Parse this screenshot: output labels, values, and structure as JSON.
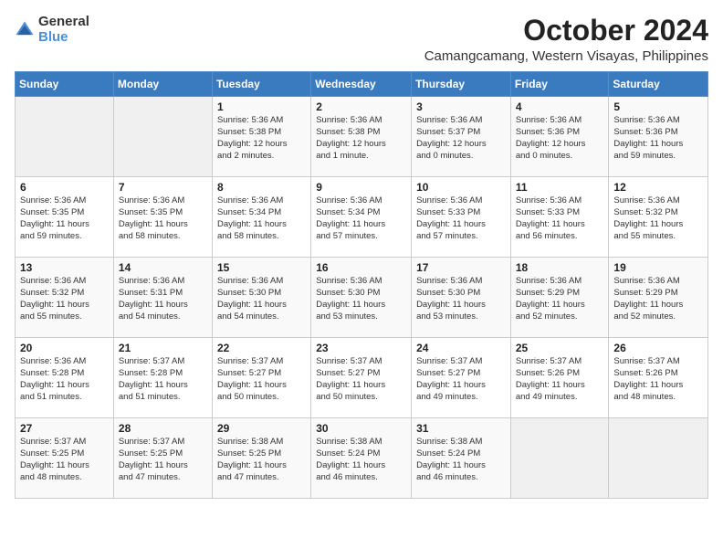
{
  "logo": {
    "text_general": "General",
    "text_blue": "Blue"
  },
  "title": "October 2024",
  "location": "Camangcamang, Western Visayas, Philippines",
  "days_of_week": [
    "Sunday",
    "Monday",
    "Tuesday",
    "Wednesday",
    "Thursday",
    "Friday",
    "Saturday"
  ],
  "weeks": [
    [
      {
        "day": "",
        "info": ""
      },
      {
        "day": "",
        "info": ""
      },
      {
        "day": "1",
        "info": "Sunrise: 5:36 AM\nSunset: 5:38 PM\nDaylight: 12 hours\nand 2 minutes."
      },
      {
        "day": "2",
        "info": "Sunrise: 5:36 AM\nSunset: 5:38 PM\nDaylight: 12 hours\nand 1 minute."
      },
      {
        "day": "3",
        "info": "Sunrise: 5:36 AM\nSunset: 5:37 PM\nDaylight: 12 hours\nand 0 minutes."
      },
      {
        "day": "4",
        "info": "Sunrise: 5:36 AM\nSunset: 5:36 PM\nDaylight: 12 hours\nand 0 minutes."
      },
      {
        "day": "5",
        "info": "Sunrise: 5:36 AM\nSunset: 5:36 PM\nDaylight: 11 hours\nand 59 minutes."
      }
    ],
    [
      {
        "day": "6",
        "info": "Sunrise: 5:36 AM\nSunset: 5:35 PM\nDaylight: 11 hours\nand 59 minutes."
      },
      {
        "day": "7",
        "info": "Sunrise: 5:36 AM\nSunset: 5:35 PM\nDaylight: 11 hours\nand 58 minutes."
      },
      {
        "day": "8",
        "info": "Sunrise: 5:36 AM\nSunset: 5:34 PM\nDaylight: 11 hours\nand 58 minutes."
      },
      {
        "day": "9",
        "info": "Sunrise: 5:36 AM\nSunset: 5:34 PM\nDaylight: 11 hours\nand 57 minutes."
      },
      {
        "day": "10",
        "info": "Sunrise: 5:36 AM\nSunset: 5:33 PM\nDaylight: 11 hours\nand 57 minutes."
      },
      {
        "day": "11",
        "info": "Sunrise: 5:36 AM\nSunset: 5:33 PM\nDaylight: 11 hours\nand 56 minutes."
      },
      {
        "day": "12",
        "info": "Sunrise: 5:36 AM\nSunset: 5:32 PM\nDaylight: 11 hours\nand 55 minutes."
      }
    ],
    [
      {
        "day": "13",
        "info": "Sunrise: 5:36 AM\nSunset: 5:32 PM\nDaylight: 11 hours\nand 55 minutes."
      },
      {
        "day": "14",
        "info": "Sunrise: 5:36 AM\nSunset: 5:31 PM\nDaylight: 11 hours\nand 54 minutes."
      },
      {
        "day": "15",
        "info": "Sunrise: 5:36 AM\nSunset: 5:30 PM\nDaylight: 11 hours\nand 54 minutes."
      },
      {
        "day": "16",
        "info": "Sunrise: 5:36 AM\nSunset: 5:30 PM\nDaylight: 11 hours\nand 53 minutes."
      },
      {
        "day": "17",
        "info": "Sunrise: 5:36 AM\nSunset: 5:30 PM\nDaylight: 11 hours\nand 53 minutes."
      },
      {
        "day": "18",
        "info": "Sunrise: 5:36 AM\nSunset: 5:29 PM\nDaylight: 11 hours\nand 52 minutes."
      },
      {
        "day": "19",
        "info": "Sunrise: 5:36 AM\nSunset: 5:29 PM\nDaylight: 11 hours\nand 52 minutes."
      }
    ],
    [
      {
        "day": "20",
        "info": "Sunrise: 5:36 AM\nSunset: 5:28 PM\nDaylight: 11 hours\nand 51 minutes."
      },
      {
        "day": "21",
        "info": "Sunrise: 5:37 AM\nSunset: 5:28 PM\nDaylight: 11 hours\nand 51 minutes."
      },
      {
        "day": "22",
        "info": "Sunrise: 5:37 AM\nSunset: 5:27 PM\nDaylight: 11 hours\nand 50 minutes."
      },
      {
        "day": "23",
        "info": "Sunrise: 5:37 AM\nSunset: 5:27 PM\nDaylight: 11 hours\nand 50 minutes."
      },
      {
        "day": "24",
        "info": "Sunrise: 5:37 AM\nSunset: 5:27 PM\nDaylight: 11 hours\nand 49 minutes."
      },
      {
        "day": "25",
        "info": "Sunrise: 5:37 AM\nSunset: 5:26 PM\nDaylight: 11 hours\nand 49 minutes."
      },
      {
        "day": "26",
        "info": "Sunrise: 5:37 AM\nSunset: 5:26 PM\nDaylight: 11 hours\nand 48 minutes."
      }
    ],
    [
      {
        "day": "27",
        "info": "Sunrise: 5:37 AM\nSunset: 5:25 PM\nDaylight: 11 hours\nand 48 minutes."
      },
      {
        "day": "28",
        "info": "Sunrise: 5:37 AM\nSunset: 5:25 PM\nDaylight: 11 hours\nand 47 minutes."
      },
      {
        "day": "29",
        "info": "Sunrise: 5:38 AM\nSunset: 5:25 PM\nDaylight: 11 hours\nand 47 minutes."
      },
      {
        "day": "30",
        "info": "Sunrise: 5:38 AM\nSunset: 5:24 PM\nDaylight: 11 hours\nand 46 minutes."
      },
      {
        "day": "31",
        "info": "Sunrise: 5:38 AM\nSunset: 5:24 PM\nDaylight: 11 hours\nand 46 minutes."
      },
      {
        "day": "",
        "info": ""
      },
      {
        "day": "",
        "info": ""
      }
    ]
  ]
}
